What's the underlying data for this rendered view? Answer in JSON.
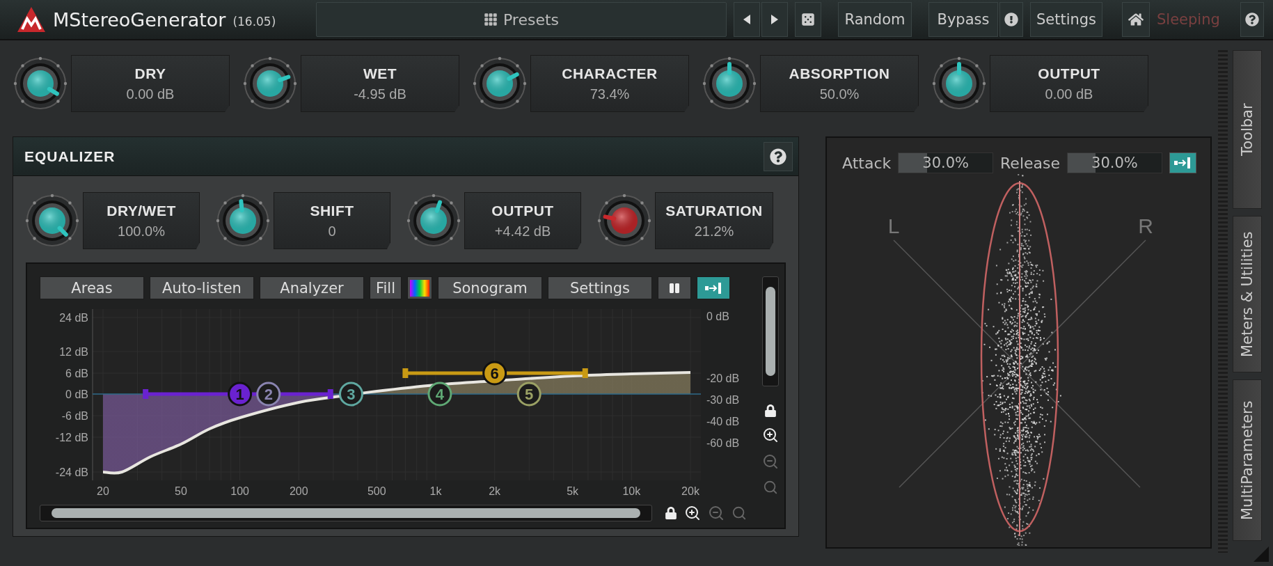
{
  "header": {
    "title": "MStereoGenerator",
    "version": "(16.05)",
    "presets": "Presets",
    "random": "Random",
    "bypass": "Bypass",
    "settings": "Settings",
    "status": "Sleeping"
  },
  "knobs": [
    {
      "label": "DRY",
      "value": "0.00 dB",
      "level": 0.95,
      "color": "#2fc4be"
    },
    {
      "label": "WET",
      "value": "-4.95 dB",
      "level": 0.76,
      "color": "#2fc4be"
    },
    {
      "label": "CHARACTER",
      "value": "73.4%",
      "level": 0.73,
      "color": "#2fc4be"
    },
    {
      "label": "ABSORPTION",
      "value": "50.0%",
      "level": 0.5,
      "color": "#2fc4be"
    },
    {
      "label": "OUTPUT",
      "value": "0.00 dB",
      "level": 0.5,
      "color": "#2fc4be"
    }
  ],
  "equalizer": {
    "title": "EQUALIZER",
    "knobs": [
      {
        "label": "DRY/WET",
        "value": "100.0%",
        "level": 1.0,
        "color": "#2fc4be"
      },
      {
        "label": "SHIFT",
        "value": "0",
        "level": 0.48,
        "color": "#2fc4be"
      },
      {
        "label": "OUTPUT",
        "value": "+4.42 dB",
        "level": 0.57,
        "color": "#2fc4be"
      },
      {
        "label": "SATURATION",
        "value": "21.2%",
        "level": 0.21,
        "color": "#c8282c"
      }
    ],
    "toolbar": [
      {
        "kind": "text",
        "label": "Areas"
      },
      {
        "kind": "text",
        "label": "Auto-listen"
      },
      {
        "kind": "text",
        "label": "Analyzer"
      },
      {
        "kind": "text",
        "label": "Fill"
      },
      {
        "kind": "spectrum"
      },
      {
        "kind": "text",
        "label": "Sonogram"
      },
      {
        "kind": "text",
        "label": "Settings"
      },
      {
        "kind": "pause"
      },
      {
        "kind": "collapse"
      }
    ],
    "graph": {
      "gain_labels": [
        "24 dB",
        "12 dB",
        "6 dB",
        "0 dB",
        "-6 dB",
        "-12 dB",
        "-24 dB"
      ],
      "analyzer_labels": [
        "0 dB",
        "-20 dB",
        "-30 dB",
        "-40 dB",
        "-60 dB"
      ],
      "frequency_labels": [
        "20",
        "50",
        "100",
        "200",
        "500",
        "1k",
        "2k",
        "5k",
        "10k",
        "20k"
      ],
      "bands": [
        {
          "number": "1",
          "color": "#6a22d0",
          "enabled": true
        },
        {
          "number": "2",
          "color": "#8a84b0",
          "enabled": false
        },
        {
          "number": "3",
          "color": "#5fa8a0",
          "enabled": false
        },
        {
          "number": "4",
          "color": "#5fa874",
          "enabled": false
        },
        {
          "number": "5",
          "color": "#9aa064",
          "enabled": false
        },
        {
          "number": "6",
          "color": "#c99a14",
          "enabled": true
        }
      ]
    }
  },
  "meter": {
    "attack": {
      "label": "Attack",
      "value": "30.0%",
      "level": 0.3
    },
    "release": {
      "label": "Release",
      "value": "30.0%",
      "level": 0.3
    },
    "left_label": "L",
    "right_label": "R"
  },
  "side_tabs": [
    "Toolbar",
    "Meters & Utilities",
    "MultiParameters"
  ]
}
